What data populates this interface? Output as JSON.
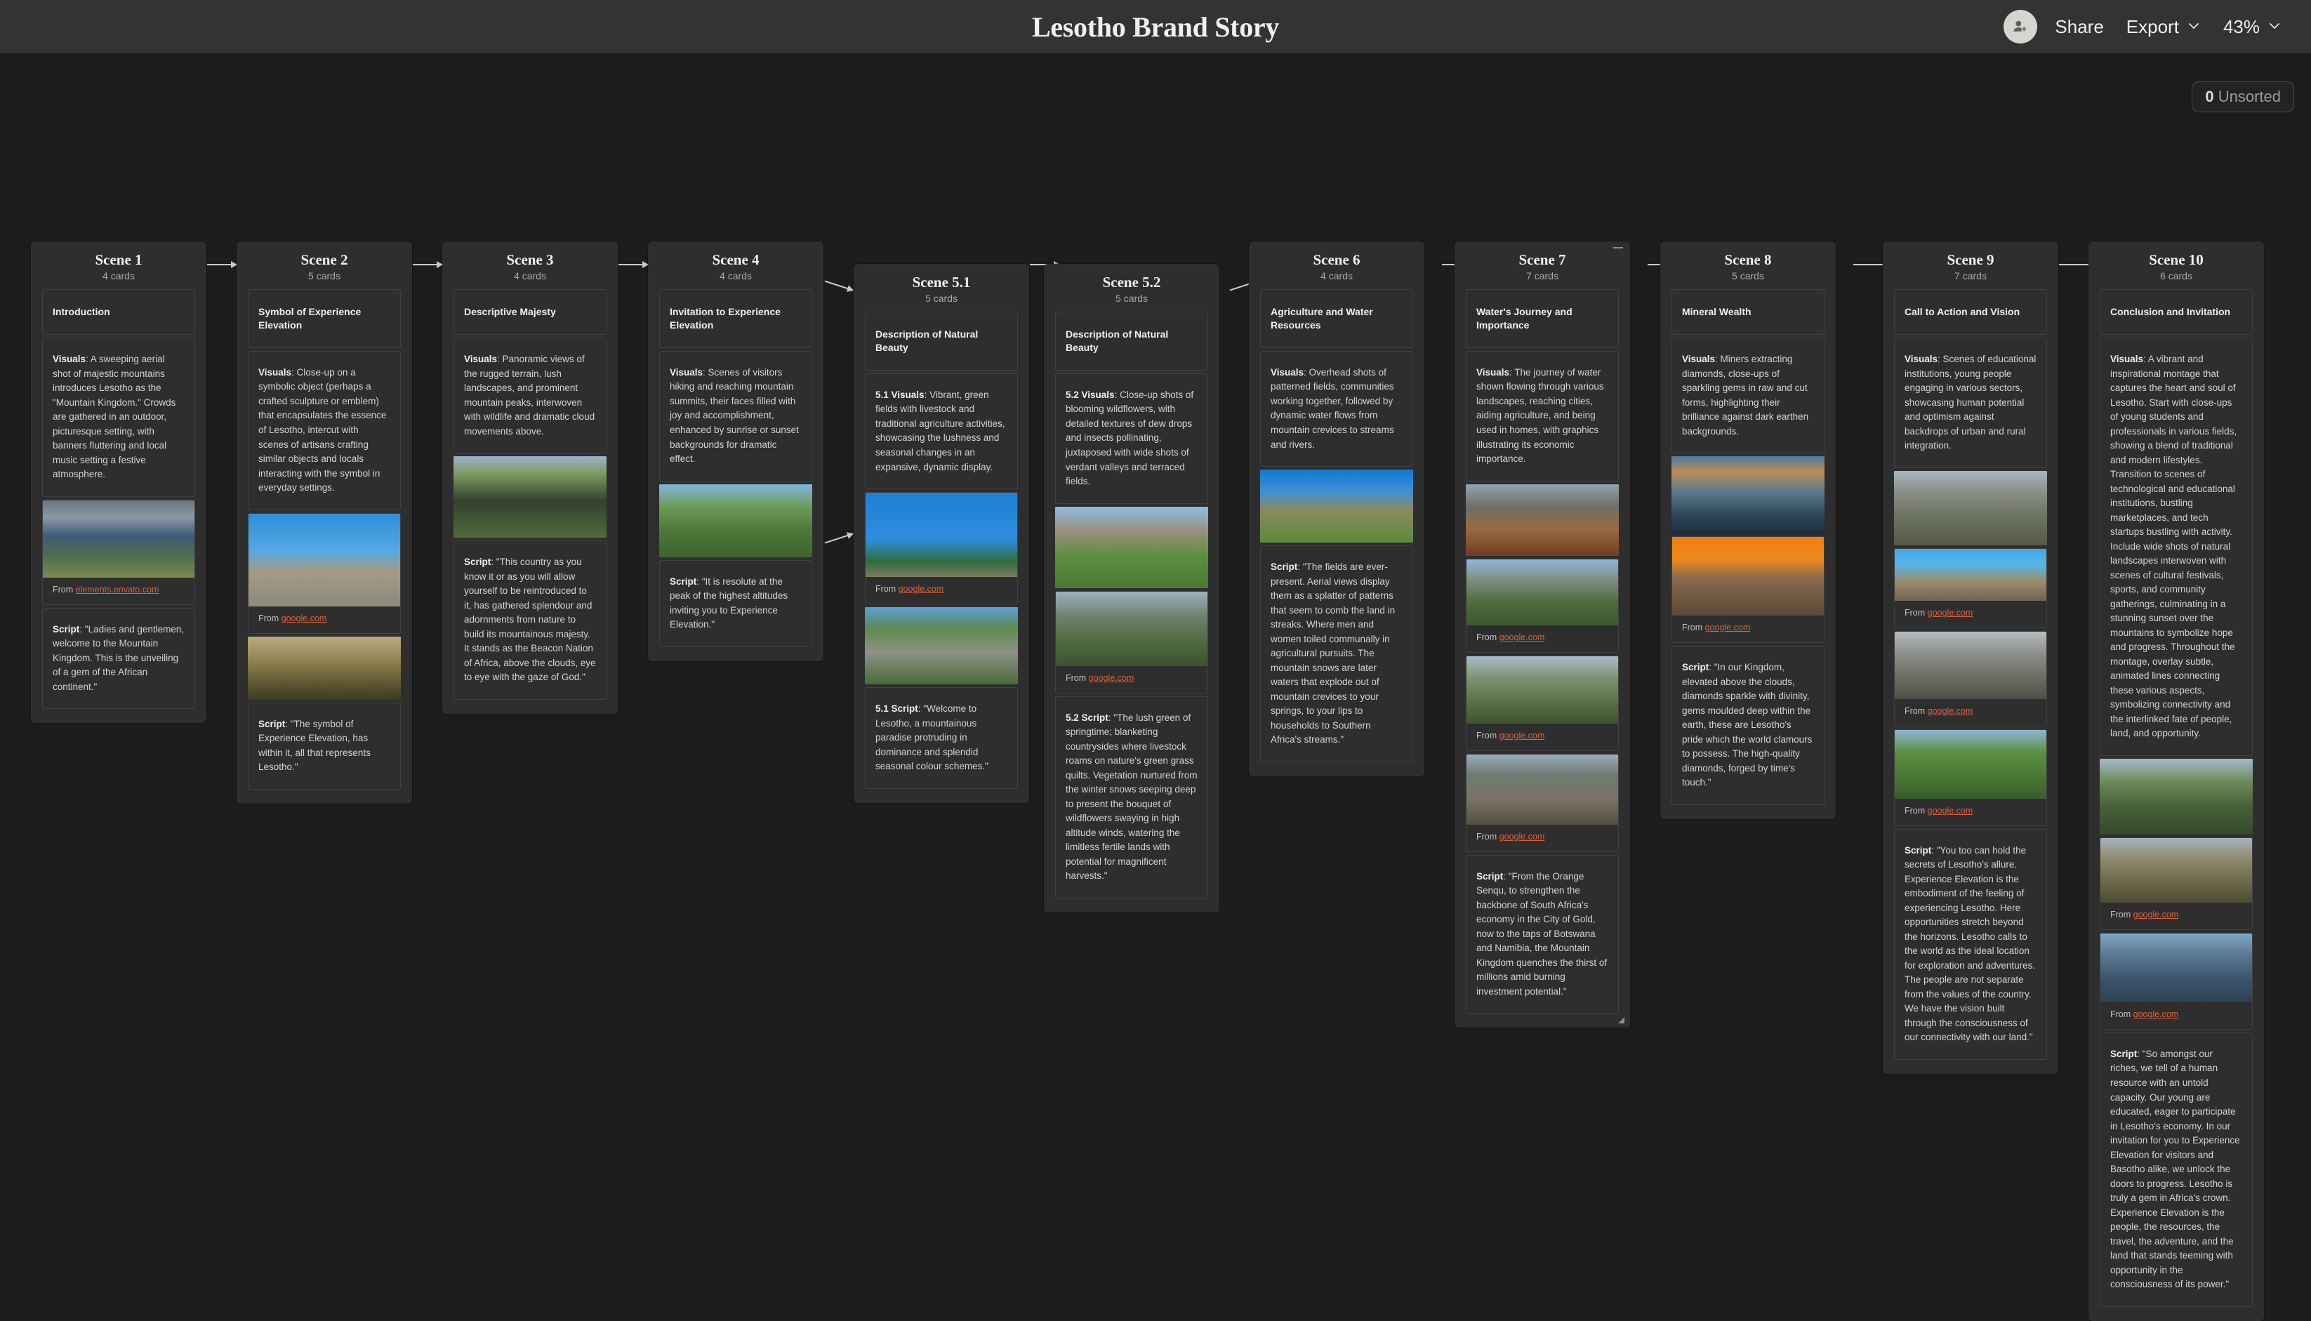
{
  "topbar": {
    "title": "Lesotho Brand Story",
    "share_label": "Share",
    "export_label": "Export",
    "zoom_label": "43%",
    "avatar_icon": "person-add-icon",
    "export_chevron_icon": "chevron-down-icon",
    "zoom_chevron_icon": "chevron-down-icon"
  },
  "canvas": {
    "unsorted_count": "0",
    "unsorted_label": "Unsorted",
    "accent_link_color": "#e0603a"
  },
  "columns": [
    {
      "title": "Scene 1",
      "count": "4 cards",
      "cards": [
        {
          "type": "heading",
          "text": "Introduction"
        },
        {
          "type": "text",
          "lead": "Visuals",
          "text": ": A sweeping aerial shot of majestic mountains introduces Lesotho as the \"Mountain Kingdom.\" Crowds are gathered in an outdoor, picturesque setting, with banners fluttering and local music setting a festive atmosphere."
        },
        {
          "type": "image",
          "alt": "aerial-mountains-photo",
          "source_prefix": "From ",
          "source": "elements.envato.com"
        },
        {
          "type": "text",
          "lead": "Script",
          "text": ": \"Ladies and gentlemen, welcome to the Mountain Kingdom. This is the unveiling of a gem of the African continent.\""
        }
      ]
    },
    {
      "title": "Scene 2",
      "count": "5 cards",
      "cards": [
        {
          "type": "heading",
          "text": "Symbol of Experience Elevation"
        },
        {
          "type": "text",
          "lead": "Visuals",
          "text": ": Close-up on a symbolic object (perhaps a crafted sculpture or emblem) that encapsulates the essence of Lesotho, intercut with scenes of artisans crafting similar objects and locals interacting with the symbol in everyday settings."
        },
        {
          "type": "image",
          "alt": "thatched-roof-building-photo",
          "source_prefix": "From ",
          "source": "google.com"
        },
        {
          "type": "image",
          "alt": "cattle-in-field-photo"
        },
        {
          "type": "text",
          "lead": "Script",
          "text": ": \"The symbol of Experience Elevation, has within it, all that represents Lesotho.\""
        }
      ]
    },
    {
      "title": "Scene 3",
      "count": "4 cards",
      "cards": [
        {
          "type": "heading",
          "text": "Descriptive Majesty"
        },
        {
          "type": "text",
          "lead": "Visuals",
          "text": ": Panoramic views of the rugged terrain, lush landscapes, and prominent mountain peaks, interwoven with wildlife and dramatic cloud movements above."
        },
        {
          "type": "image",
          "alt": "waterfall-canyon-photo"
        },
        {
          "type": "text",
          "lead": "Script",
          "text": ": \"This country as you know it or as you will allow yourself to be reintroduced to it, has gathered splendour and adornments from nature to build its mountainous majesty. It stands as the Beacon Nation of Africa, above the clouds, eye to eye with the gaze of God.\""
        }
      ]
    },
    {
      "title": "Scene 4",
      "count": "4 cards",
      "cards": [
        {
          "type": "heading",
          "text": "Invitation to Experience Elevation"
        },
        {
          "type": "text",
          "lead": "Visuals",
          "text": ": Scenes of visitors hiking and reaching mountain summits, their faces filled with joy and accomplishment, enhanced by sunrise or sunset backgrounds for dramatic effect."
        },
        {
          "type": "image",
          "alt": "horse-rider-green-valley-photo"
        },
        {
          "type": "text",
          "lead": "Script",
          "text": ": \"It is resolute at the peak of the highest altitudes inviting you to Experience Elevation.\""
        }
      ]
    },
    {
      "title": "Scene 5.1",
      "count": "5 cards",
      "cards": [
        {
          "type": "heading",
          "text": "Description of Natural Beauty"
        },
        {
          "type": "text",
          "lead": "5.1 Visuals",
          "text": ": Vibrant, green fields with livestock and traditional agriculture activities, showcasing the lushness and seasonal changes in an expansive, dynamic display."
        },
        {
          "type": "image",
          "alt": "welcome-to-lesotho-sign-photo",
          "source_prefix": "From ",
          "source": "google.com"
        },
        {
          "type": "image",
          "alt": "traditional-huts-village-photo"
        },
        {
          "type": "text",
          "lead": "5.1 Script",
          "text": ": \"Welcome to Lesotho, a mountainous paradise protruding in dominance and splendid seasonal colour schemes.\""
        }
      ]
    },
    {
      "title": "Scene 5.2",
      "count": "5 cards",
      "cards": [
        {
          "type": "heading",
          "text": "Description of Natural Beauty"
        },
        {
          "type": "text",
          "lead": "5.2 Visuals",
          "text": ": Close-up shots of blooming wildflowers, with detailed textures of dew drops and insects pollinating, juxtaposed with wide shots of verdant valleys and terraced fields."
        },
        {
          "type": "image",
          "alt": "basotho-blankets-people-photo"
        },
        {
          "type": "image",
          "alt": "green-mountain-slopes-photo",
          "source_prefix": "From ",
          "source": "google.com"
        },
        {
          "type": "text",
          "lead": "5.2 Script",
          "text": ": \"The lush green of springtime; blanketing countrysides where livestock roams on nature's green grass quilts. Vegetation nurtured from the winter snows seeping deep to present the bouquet of wildflowers swaying in high altitude winds, watering the limitless fertile lands with potential for magnificent harvests.\""
        }
      ]
    },
    {
      "title": "Scene 6",
      "count": "4 cards",
      "cards": [
        {
          "type": "heading",
          "text": "Agriculture and Water Resources"
        },
        {
          "type": "text",
          "lead": "Visuals",
          "text": ": Overhead shots of patterned fields, communities working together, followed by dynamic water flows from mountain crevices to streams and rivers."
        },
        {
          "type": "image",
          "alt": "village-huts-hillside-photo"
        },
        {
          "type": "text",
          "lead": "Script",
          "text": ": \"The fields are ever-present. Aerial views display them as a splatter of patterns that seem to comb the land in streaks. Where men and women toiled communally in agricultural pursuits. The mountain snows are later waters that explode out of mountain crevices to your springs, to your lips to households to Southern Africa's streams.\""
        }
      ]
    },
    {
      "title": "Scene 7",
      "count": "7 cards",
      "cards": [
        {
          "type": "heading",
          "text": "Water's Journey and Importance"
        },
        {
          "type": "text",
          "lead": "Visuals",
          "text": ": The journey of water shown flowing through various landscapes, reaching cities, aiding agriculture, and being used in homes, with graphics illustrating its economic importance."
        },
        {
          "type": "image",
          "alt": "blossom-trees-mountain-photo"
        },
        {
          "type": "image",
          "alt": "maletsunyane-falls-photo",
          "source_prefix": "From ",
          "source": "google.com"
        },
        {
          "type": "image",
          "alt": "green-valley-town-photo",
          "source_prefix": "From ",
          "source": "google.com"
        },
        {
          "type": "image",
          "alt": "maseru-city-view-photo",
          "source_prefix": "From ",
          "source": "google.com"
        },
        {
          "type": "text",
          "lead": "Script",
          "text": ": \"From the Orange Senqu, to strengthen the backbone of South Africa's economy in the City of Gold, now to the taps of Botswana and Namibia, the Mountain Kingdom quenches the thirst of millions amid burning investment potential.\""
        }
      ]
    },
    {
      "title": "Scene 8",
      "count": "5 cards",
      "cards": [
        {
          "type": "heading",
          "text": "Mineral Wealth"
        },
        {
          "type": "text",
          "lead": "Visuals",
          "text": ": Miners extracting diamonds, close-ups of sparkling gems in raw and cut forms, highlighting their brilliance against dark earthen backgrounds."
        },
        {
          "type": "image",
          "alt": "open-pit-diamond-mine-photo"
        },
        {
          "type": "image",
          "alt": "hand-holding-rough-diamond-photo",
          "source_prefix": "From ",
          "source": "google.com"
        },
        {
          "type": "text",
          "lead": "Script",
          "text": ": \"In our Kingdom, elevated above the clouds, diamonds sparkle with divinity, gems moulded deep within the earth, these are Lesotho's pride which the world clamours to possess. The high-quality diamonds, forged by time's touch.\""
        }
      ]
    },
    {
      "title": "Scene 9",
      "count": "7 cards",
      "cards": [
        {
          "type": "heading",
          "text": "Call to Action and Vision"
        },
        {
          "type": "text",
          "lead": "Visuals",
          "text": ": Scenes of educational institutions, young people engaging in various sectors, showcasing human potential and optimism against backdrops of urban and rural integration."
        },
        {
          "type": "image",
          "alt": "maseru-skyline-photo"
        },
        {
          "type": "image",
          "alt": "horseman-red-hat-photo",
          "source_prefix": "From ",
          "source": "google.com"
        },
        {
          "type": "image",
          "alt": "street-crowd-photo",
          "source_prefix": "From ",
          "source": "google.com"
        },
        {
          "type": "image",
          "alt": "sports-field-aerial-photo",
          "source_prefix": "From ",
          "source": "google.com"
        },
        {
          "type": "text",
          "lead": "Script",
          "text": ": \"You too can hold the secrets of Lesotho's allure. Experience Elevation is the embodiment of the feeling of experiencing Lesotho. Here opportunities stretch beyond the horizons. Lesotho calls to the world as the ideal location for exploration and adventures. The people are not separate from the values of the country. We have the vision built through the consciousness of our connectivity with our land.\""
        }
      ]
    },
    {
      "title": "Scene 10",
      "count": "6 cards",
      "cards": [
        {
          "type": "heading",
          "text": "Conclusion and Invitation"
        },
        {
          "type": "text",
          "lead": "Visuals",
          "text": ": A vibrant and inspirational montage that captures the heart and soul of Lesotho. Start with close-ups of young students and professionals in various fields, showing a blend of traditional and modern lifestyles. Transition to scenes of technological and educational institutions, bustling marketplaces, and tech startups bustling with activity. Include wide shots of natural landscapes interwoven with scenes of cultural festivals, sports, and community gatherings, culminating in a stunning sunset over the mountains to symbolize hope and progress. Throughout the montage, overlay subtle, animated lines connecting these various aspects, symbolizing connectivity and the interlinked fate of people, land, and opportunity."
        },
        {
          "type": "image",
          "alt": "waterfall-cliff-photo"
        },
        {
          "type": "image",
          "alt": "cattle-herd-mountain-photo",
          "source_prefix": "From ",
          "source": "google.com"
        },
        {
          "type": "image",
          "alt": "man-blanket-portrait-photo",
          "source_prefix": "From ",
          "source": "google.com"
        },
        {
          "type": "text",
          "lead": "Script",
          "text": ": \"So amongst our riches, we tell of a human resource with an untold capacity. Our young are educated, eager to participate in Lesotho's economy. In our invitation for you to Experience Elevation for visitors and Basotho alike, we unlock the doors to progress. Lesotho is truly a gem in Africa's crown. Experience Elevation is the people, the resources, the travel, the adventure, and the land that stands teeming with opportunity in the consciousness of its power.\""
        }
      ]
    }
  ]
}
